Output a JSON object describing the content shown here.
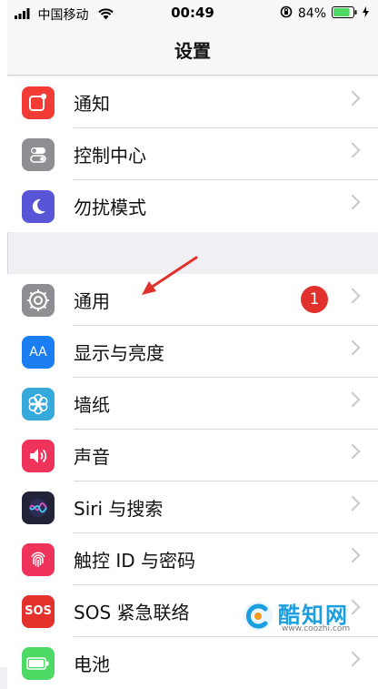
{
  "status_bar": {
    "carrier": "中国移动",
    "time": "00:49",
    "battery_percent": "84%",
    "battery_level": 0.84,
    "icons": [
      "signal-icon",
      "wifi-icon",
      "orientation-lock-icon",
      "battery-icon",
      "charging-icon"
    ]
  },
  "nav": {
    "title": "设置"
  },
  "groups": [
    {
      "items": [
        {
          "label": "通知",
          "icon": "notifications-icon",
          "color": "#f23b35"
        },
        {
          "label": "控制中心",
          "icon": "control-center-icon",
          "color": "#8e8e93"
        },
        {
          "label": "勿扰模式",
          "icon": "moon-icon",
          "color": "#5856d6"
        }
      ]
    },
    {
      "items": [
        {
          "label": "通用",
          "icon": "gear-icon",
          "color": "#8e8e93",
          "badge": "1"
        },
        {
          "label": "显示与亮度",
          "icon": "display-icon",
          "color": "#1a7df2",
          "icon_text": "AA"
        },
        {
          "label": "墙纸",
          "icon": "wallpaper-icon",
          "color": "#36aadc"
        },
        {
          "label": "声音",
          "icon": "speaker-icon",
          "color": "#f0335a"
        },
        {
          "label": "Siri 与搜索",
          "icon": "siri-icon",
          "color": "#222238"
        },
        {
          "label": "触控 ID 与密码",
          "icon": "fingerprint-icon",
          "color": "#f0335a"
        },
        {
          "label": "SOS 紧急联络",
          "icon": "sos-icon",
          "color": "#e3322b",
          "icon_text": "SOS"
        },
        {
          "label": "电池",
          "icon": "battery-setting-icon",
          "color": "#4cd964"
        }
      ]
    }
  ],
  "watermark": {
    "name": "酷知网",
    "url": "www.coozhi.com"
  },
  "colors": {
    "accent_arrow": "#e0312c",
    "badge": "#e0312c",
    "chevron": "#c7c7cc"
  }
}
